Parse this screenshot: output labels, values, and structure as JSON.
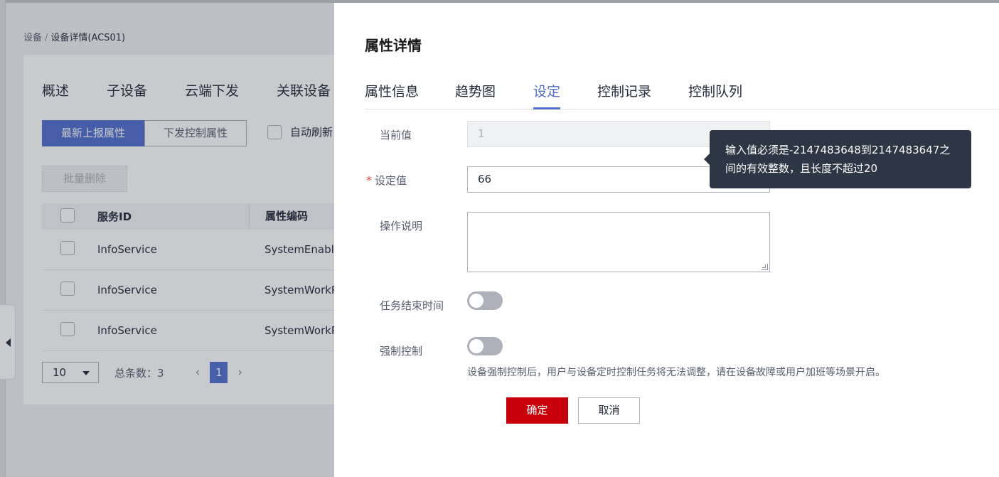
{
  "background": {
    "breadcrumb": {
      "root": "设备",
      "separator": "/",
      "current": "设备详情(ACS01)"
    },
    "tabs": [
      "概述",
      "子设备",
      "云端下发",
      "关联设备"
    ],
    "button_group": {
      "active": "最新上报属性",
      "inactive": "下发控制属性"
    },
    "auto_refresh_label": "自动刷新",
    "batch_delete_label": "批量删除",
    "table": {
      "headers": {
        "service_id": "服务ID",
        "attr_code": "属性编码"
      },
      "rows": [
        {
          "service_id": "InfoService",
          "attr_code": "SystemEnableSp"
        },
        {
          "service_id": "InfoService",
          "attr_code": "SystemWorkPres"
        },
        {
          "service_id": "InfoService",
          "attr_code": "SystemWorkPres"
        }
      ]
    },
    "pagination": {
      "page_size": "10",
      "total_label": "总条数：3",
      "prev": "‹",
      "current_page": "1",
      "next": "›"
    }
  },
  "drawer": {
    "title": "属性详情",
    "tabs": [
      "属性信息",
      "趋势图",
      "设定",
      "控制记录",
      "控制队列"
    ],
    "active_tab": "设定",
    "form": {
      "current_value_label": "当前值",
      "current_value": "1",
      "required_mark": "*",
      "set_value_label": "设定值",
      "set_value": "66",
      "description_label": "操作说明",
      "description_value": "",
      "task_end_time_label": "任务结束时间",
      "task_end_time_enabled": false,
      "force_control_label": "强制控制",
      "force_control_enabled": false,
      "force_control_hint": "设备强制控制后，用户与设备定时控制任务将无法调整，请在设备故障或用户加班等场景开启。"
    },
    "buttons": {
      "confirm": "确定",
      "cancel": "取消"
    },
    "tooltip": "输入值必须是-2147483648到2147483647之间的有效整数，且长度不超过20"
  },
  "colors": {
    "primary": "#526ecc",
    "danger": "#c7000b",
    "tooltip_bg": "#2d3644",
    "required": "#e54545"
  }
}
